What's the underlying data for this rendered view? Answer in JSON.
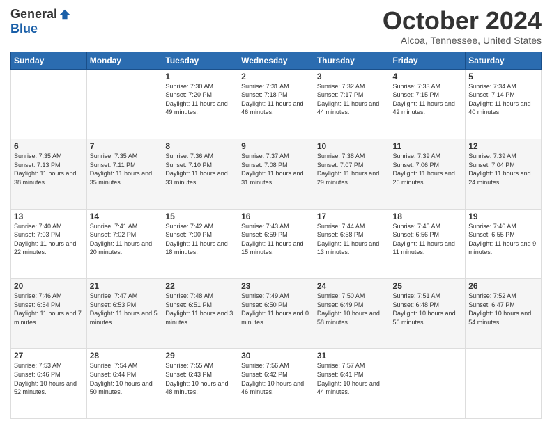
{
  "logo": {
    "general": "General",
    "blue": "Blue"
  },
  "title": "October 2024",
  "location": "Alcoa, Tennessee, United States",
  "days_of_week": [
    "Sunday",
    "Monday",
    "Tuesday",
    "Wednesday",
    "Thursday",
    "Friday",
    "Saturday"
  ],
  "weeks": [
    [
      {
        "day": "",
        "info": ""
      },
      {
        "day": "",
        "info": ""
      },
      {
        "day": "1",
        "info": "Sunrise: 7:30 AM\nSunset: 7:20 PM\nDaylight: 11 hours and 49 minutes."
      },
      {
        "day": "2",
        "info": "Sunrise: 7:31 AM\nSunset: 7:18 PM\nDaylight: 11 hours and 46 minutes."
      },
      {
        "day": "3",
        "info": "Sunrise: 7:32 AM\nSunset: 7:17 PM\nDaylight: 11 hours and 44 minutes."
      },
      {
        "day": "4",
        "info": "Sunrise: 7:33 AM\nSunset: 7:15 PM\nDaylight: 11 hours and 42 minutes."
      },
      {
        "day": "5",
        "info": "Sunrise: 7:34 AM\nSunset: 7:14 PM\nDaylight: 11 hours and 40 minutes."
      }
    ],
    [
      {
        "day": "6",
        "info": "Sunrise: 7:35 AM\nSunset: 7:13 PM\nDaylight: 11 hours and 38 minutes."
      },
      {
        "day": "7",
        "info": "Sunrise: 7:35 AM\nSunset: 7:11 PM\nDaylight: 11 hours and 35 minutes."
      },
      {
        "day": "8",
        "info": "Sunrise: 7:36 AM\nSunset: 7:10 PM\nDaylight: 11 hours and 33 minutes."
      },
      {
        "day": "9",
        "info": "Sunrise: 7:37 AM\nSunset: 7:08 PM\nDaylight: 11 hours and 31 minutes."
      },
      {
        "day": "10",
        "info": "Sunrise: 7:38 AM\nSunset: 7:07 PM\nDaylight: 11 hours and 29 minutes."
      },
      {
        "day": "11",
        "info": "Sunrise: 7:39 AM\nSunset: 7:06 PM\nDaylight: 11 hours and 26 minutes."
      },
      {
        "day": "12",
        "info": "Sunrise: 7:39 AM\nSunset: 7:04 PM\nDaylight: 11 hours and 24 minutes."
      }
    ],
    [
      {
        "day": "13",
        "info": "Sunrise: 7:40 AM\nSunset: 7:03 PM\nDaylight: 11 hours and 22 minutes."
      },
      {
        "day": "14",
        "info": "Sunrise: 7:41 AM\nSunset: 7:02 PM\nDaylight: 11 hours and 20 minutes."
      },
      {
        "day": "15",
        "info": "Sunrise: 7:42 AM\nSunset: 7:00 PM\nDaylight: 11 hours and 18 minutes."
      },
      {
        "day": "16",
        "info": "Sunrise: 7:43 AM\nSunset: 6:59 PM\nDaylight: 11 hours and 15 minutes."
      },
      {
        "day": "17",
        "info": "Sunrise: 7:44 AM\nSunset: 6:58 PM\nDaylight: 11 hours and 13 minutes."
      },
      {
        "day": "18",
        "info": "Sunrise: 7:45 AM\nSunset: 6:56 PM\nDaylight: 11 hours and 11 minutes."
      },
      {
        "day": "19",
        "info": "Sunrise: 7:46 AM\nSunset: 6:55 PM\nDaylight: 11 hours and 9 minutes."
      }
    ],
    [
      {
        "day": "20",
        "info": "Sunrise: 7:46 AM\nSunset: 6:54 PM\nDaylight: 11 hours and 7 minutes."
      },
      {
        "day": "21",
        "info": "Sunrise: 7:47 AM\nSunset: 6:53 PM\nDaylight: 11 hours and 5 minutes."
      },
      {
        "day": "22",
        "info": "Sunrise: 7:48 AM\nSunset: 6:51 PM\nDaylight: 11 hours and 3 minutes."
      },
      {
        "day": "23",
        "info": "Sunrise: 7:49 AM\nSunset: 6:50 PM\nDaylight: 11 hours and 0 minutes."
      },
      {
        "day": "24",
        "info": "Sunrise: 7:50 AM\nSunset: 6:49 PM\nDaylight: 10 hours and 58 minutes."
      },
      {
        "day": "25",
        "info": "Sunrise: 7:51 AM\nSunset: 6:48 PM\nDaylight: 10 hours and 56 minutes."
      },
      {
        "day": "26",
        "info": "Sunrise: 7:52 AM\nSunset: 6:47 PM\nDaylight: 10 hours and 54 minutes."
      }
    ],
    [
      {
        "day": "27",
        "info": "Sunrise: 7:53 AM\nSunset: 6:46 PM\nDaylight: 10 hours and 52 minutes."
      },
      {
        "day": "28",
        "info": "Sunrise: 7:54 AM\nSunset: 6:44 PM\nDaylight: 10 hours and 50 minutes."
      },
      {
        "day": "29",
        "info": "Sunrise: 7:55 AM\nSunset: 6:43 PM\nDaylight: 10 hours and 48 minutes."
      },
      {
        "day": "30",
        "info": "Sunrise: 7:56 AM\nSunset: 6:42 PM\nDaylight: 10 hours and 46 minutes."
      },
      {
        "day": "31",
        "info": "Sunrise: 7:57 AM\nSunset: 6:41 PM\nDaylight: 10 hours and 44 minutes."
      },
      {
        "day": "",
        "info": ""
      },
      {
        "day": "",
        "info": ""
      }
    ]
  ]
}
